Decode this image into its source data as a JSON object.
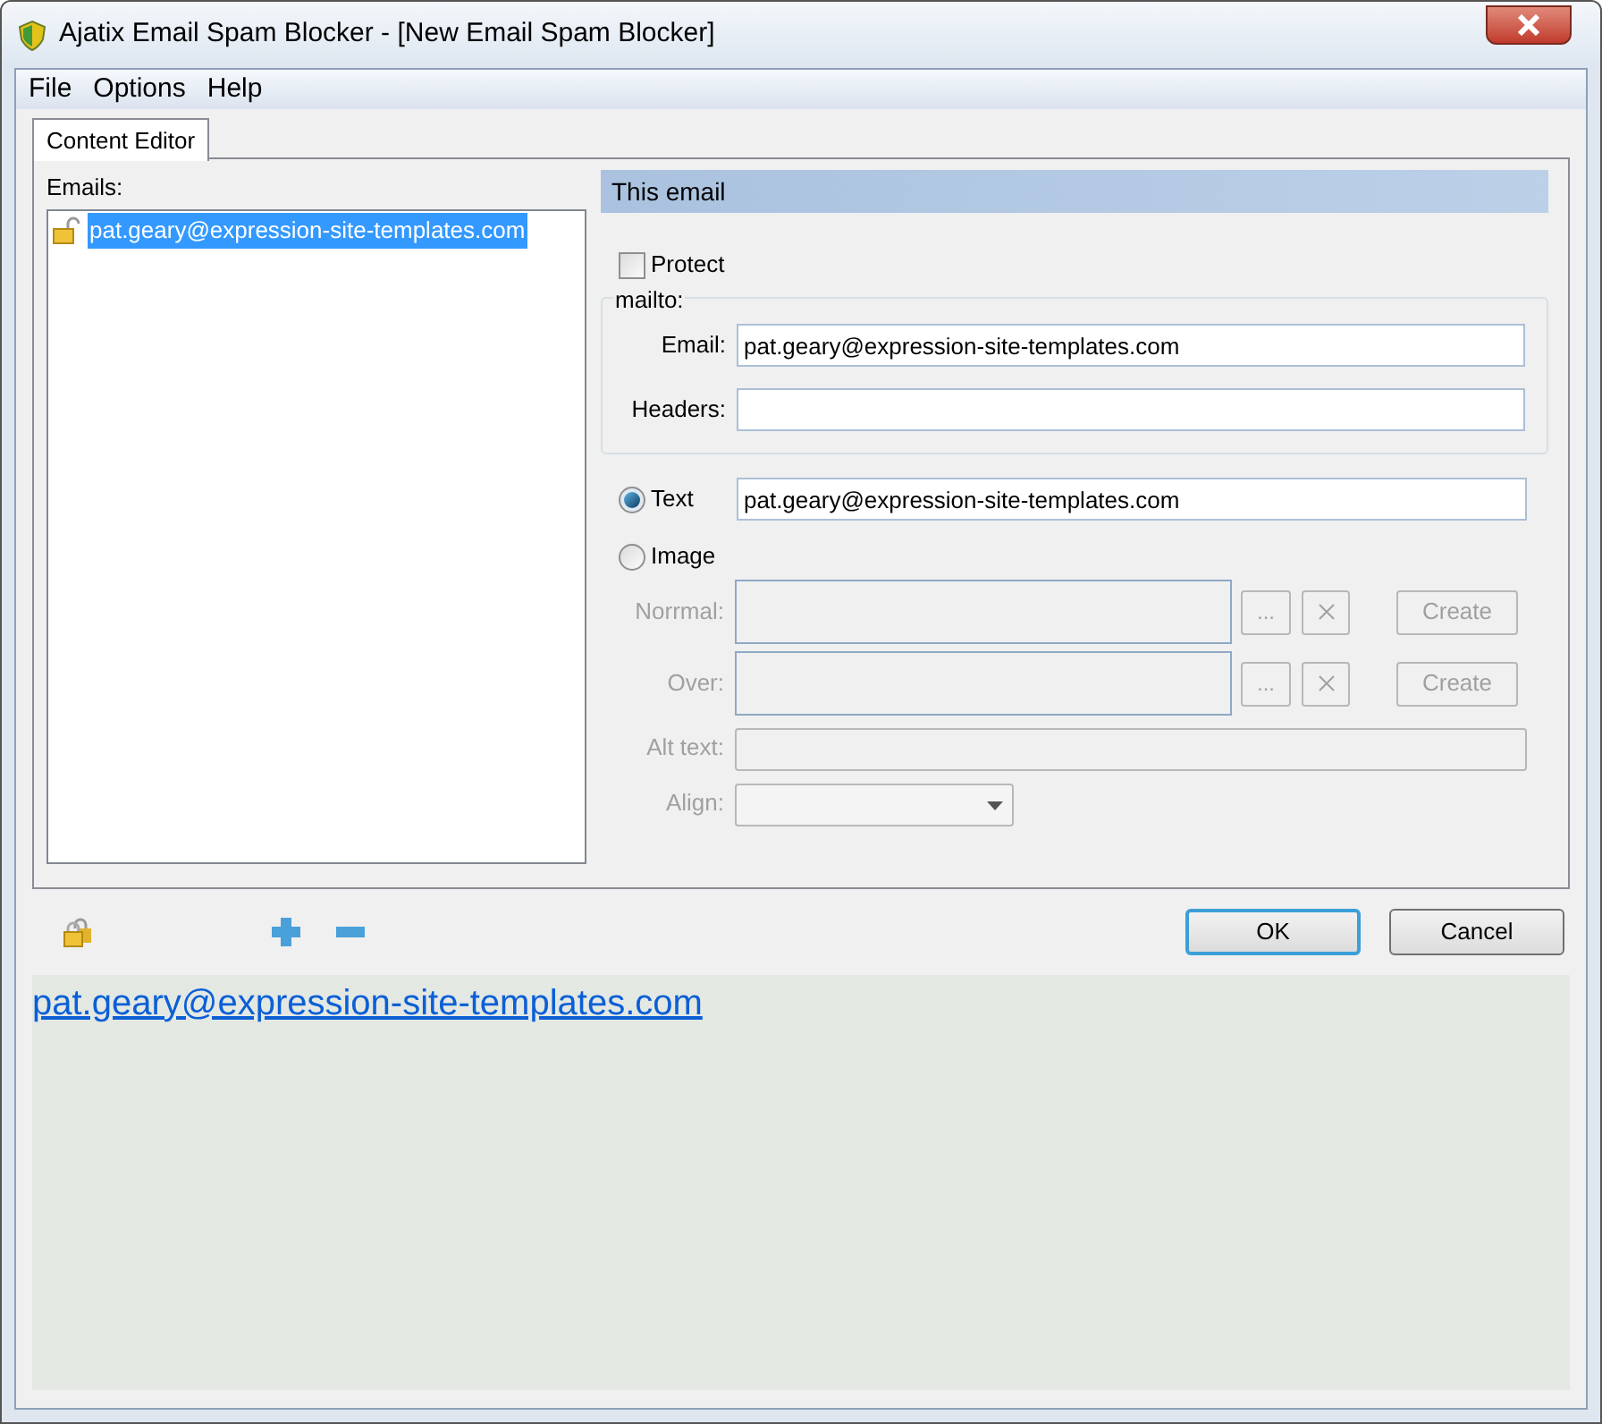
{
  "window": {
    "title": "Ajatix Email Spam Blocker - [New Email Spam Blocker]"
  },
  "menu": [
    "File",
    "Options",
    "Help"
  ],
  "tabs": [
    {
      "label": "Content Editor",
      "selected": true
    }
  ],
  "emails": {
    "label": "Emails:",
    "items": [
      {
        "text": "pat.geary@expression-site-templates.com",
        "selected": true
      }
    ]
  },
  "this_email": {
    "header": "This email",
    "protect": {
      "label": "Protect",
      "checked": false
    },
    "mailto": {
      "legend": "mailto:",
      "fields": [
        {
          "label": "Email:",
          "value": "pat.geary@expression-site-templates.com"
        },
        {
          "label": "Headers:"
        }
      ]
    },
    "text_option": {
      "label": "Text",
      "selected": true,
      "value": "pat.geary@expression-site-templates.com"
    },
    "image_option": {
      "label": "Image",
      "selected": false
    },
    "image": {
      "disabled": true,
      "rows": [
        {
          "kind": "file",
          "label": "Norrmal:",
          "browse": "...",
          "create": "Create"
        },
        {
          "kind": "file",
          "label": "Over:",
          "browse": "...",
          "create": "Create"
        },
        {
          "kind": "text",
          "label": "Alt text:"
        },
        {
          "kind": "select",
          "label": "Align:"
        }
      ]
    }
  },
  "buttons": [
    {
      "label": "OK",
      "default": true
    },
    {
      "label": "Cancel",
      "default": false
    }
  ],
  "preview": {
    "link": "pat.geary@expression-site-templates.com"
  }
}
